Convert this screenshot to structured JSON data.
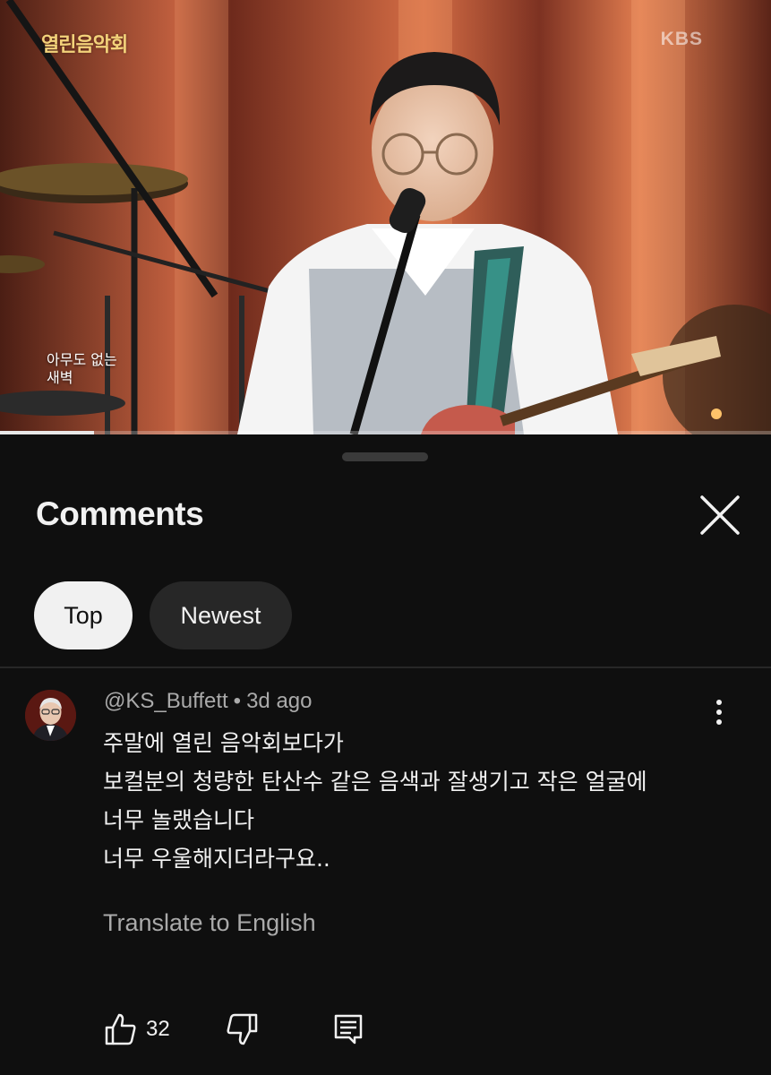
{
  "video": {
    "logo_left": "열린음악회",
    "logo_right": "KBS",
    "caption_lines": [
      "아무도 없는",
      "새벽"
    ],
    "progress_fraction": 0.122
  },
  "comments_panel": {
    "title": "Comments",
    "close_icon": "close-icon",
    "sort_chips": [
      {
        "label": "Top",
        "selected": true
      },
      {
        "label": "Newest",
        "selected": false
      }
    ]
  },
  "comment": {
    "author": "@KS_Buffett",
    "separator": "•",
    "age": "3d ago",
    "lines": [
      "주말에 열린 음악회보다가",
      "보컬분의 청량한 탄산수 같은 음색과 잘생기고 작은 얼굴에",
      "너무 놀랬습니다",
      "너무 우울해지더라구요.."
    ],
    "translate_label": "Translate to English",
    "like_count": "32",
    "icons": {
      "like": "thumbs-up-icon",
      "dislike": "thumbs-down-icon",
      "reply": "reply-icon",
      "more": "more-vert-icon"
    }
  },
  "colors": {
    "background": "#0f0f0f",
    "chip_selected": "#f1f1f1",
    "chip_unselected": "#272727",
    "secondary_text": "#aaaaaa"
  }
}
